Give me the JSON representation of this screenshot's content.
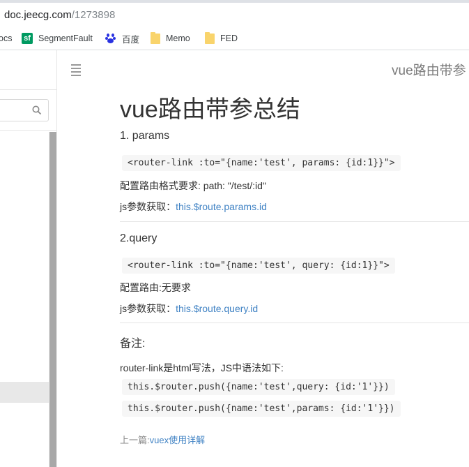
{
  "browser": {
    "url_host": "doc.jeecg.com",
    "url_path": "/1273898",
    "bookmarks": [
      {
        "label": "ocs",
        "icon": "none"
      },
      {
        "label": "SegmentFault",
        "icon": "sf-icon"
      },
      {
        "label": "百度",
        "icon": "baidu-icon"
      },
      {
        "label": "Memo",
        "icon": "folder-icon"
      },
      {
        "label": "FED",
        "icon": "folder-icon"
      }
    ],
    "sf_glyph": "sf"
  },
  "header": {
    "title": "vue路由带参"
  },
  "article": {
    "title": "vue路由带参总结",
    "section1": {
      "heading": "1. params",
      "code": "<router-link :to=\"{name:'test', params: {id:1}}\">",
      "rule": "配置路由格式要求: path: \"/test/:id\"",
      "get_prefix": "js参数获取：",
      "get_link": "this.$route.params.id"
    },
    "section2": {
      "heading": "2.query",
      "code": "<router-link :to=\"{name:'test', query: {id:1}}\">",
      "rule": "配置路由:无要求",
      "get_prefix": "js参数获取：",
      "get_link": "this.$route.query.id"
    },
    "note": {
      "heading": "备注:",
      "text": "router-link是html写法，JS中语法如下:",
      "code1": "this.$router.push({name:'test',query: {id:'1'}})",
      "code2": "this.$router.push({name:'test',params: {id:'1'}})"
    },
    "prev_label": "上一篇:",
    "prev_link": "vuex使用详解"
  }
}
